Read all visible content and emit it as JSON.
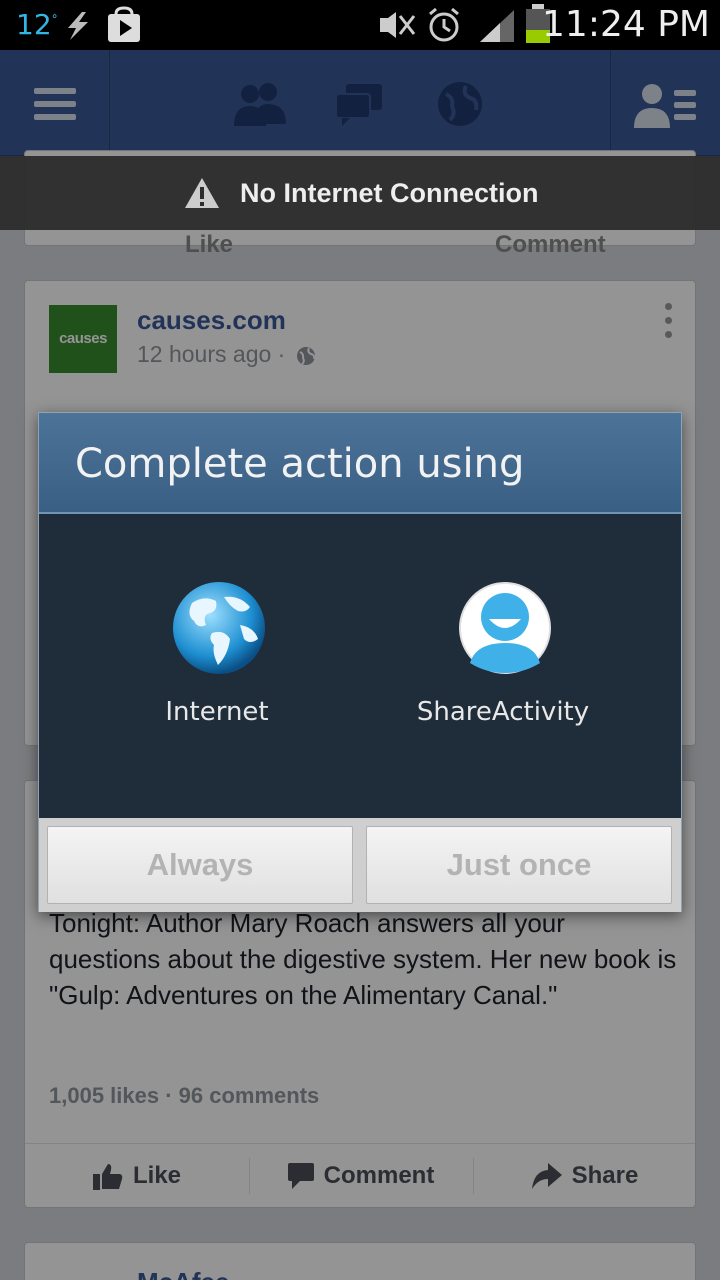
{
  "status_bar": {
    "temperature": "12",
    "degree": "°",
    "time": "11:24 PM",
    "icons": [
      "weather-temp",
      "lightning-icon",
      "play-store-icon",
      "no-sound-icon",
      "alarm-icon",
      "signal-icon",
      "battery-icon"
    ]
  },
  "app_bar": {
    "icons": [
      "menu-icon",
      "friend-requests-icon",
      "messages-icon",
      "notifications-globe-icon",
      "friends-list-icon"
    ],
    "color": "#3b5998"
  },
  "warning": {
    "text": "No Internet Connection"
  },
  "feed": {
    "card1_actions": {
      "like": "Like",
      "comment": "Comment"
    },
    "card2": {
      "author": "causes.com",
      "logo_text": "causes",
      "time": "12 hours ago",
      "separator": "·"
    },
    "card3": {
      "text": "Tonight: Author Mary Roach answers all your questions about the digestive system. Her new book is \"Gulp: Adventures on the Alimentary Canal.\"",
      "stats": "1,005 likes · 96 comments",
      "actions": {
        "like": "Like",
        "comment": "Comment",
        "share": "Share"
      }
    },
    "card4": {
      "author": "McAfee"
    }
  },
  "dialog": {
    "title": "Complete action using",
    "options": [
      {
        "label": "Internet",
        "icon": "internet-globe-icon"
      },
      {
        "label": "ShareActivity",
        "icon": "share-activity-icon"
      }
    ],
    "buttons": {
      "always": "Always",
      "just_once": "Just once"
    },
    "title_color": "#4c7398",
    "body_color": "#1f2c3a"
  }
}
